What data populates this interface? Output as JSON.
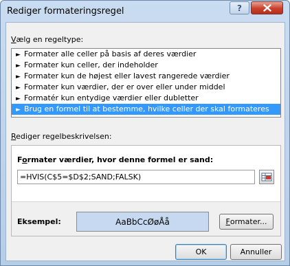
{
  "window": {
    "title": "Rediger formateringsregel",
    "help_label": "?"
  },
  "rule_type": {
    "label_underlined": "V",
    "label_rest": "ælg en regeltype:",
    "items": [
      {
        "label": "Formater alle celler på basis af deres værdier",
        "selected": false
      },
      {
        "label": "Formater kun celler, der indeholder",
        "selected": false
      },
      {
        "label": "Formater kun de højest eller lavest rangerede værdier",
        "selected": false
      },
      {
        "label": "Formater kun værdier, der er over eller under middel",
        "selected": false
      },
      {
        "label": "Formatér kun entydige værdier eller dubletter",
        "selected": false
      },
      {
        "label": "Brug en formel til at bestemme, hvilke celler der skal formateres",
        "selected": true
      }
    ],
    "arrow_glyph": "►"
  },
  "description": {
    "label_underlined": "R",
    "label_rest": "ediger regelbeskrivelsen:",
    "formula_label_underlined": "o",
    "formula_label_pre": "F",
    "formula_label_rest": "rmater værdier, hvor denne formel er sand:",
    "formula_value": "=HVIS(C$5=$D$2;SAND;FALSK)",
    "example_label": "Eksempel:",
    "example_text": "AaBbCcØøÅå",
    "example_fill": "#c6d9f0",
    "format_button_underlined": "F",
    "format_button_rest": "ormater..."
  },
  "footer": {
    "ok_label": "OK",
    "cancel_label": "Annuller"
  },
  "colors": {
    "selection": "#3399ff",
    "close_button": "#c9402c"
  }
}
